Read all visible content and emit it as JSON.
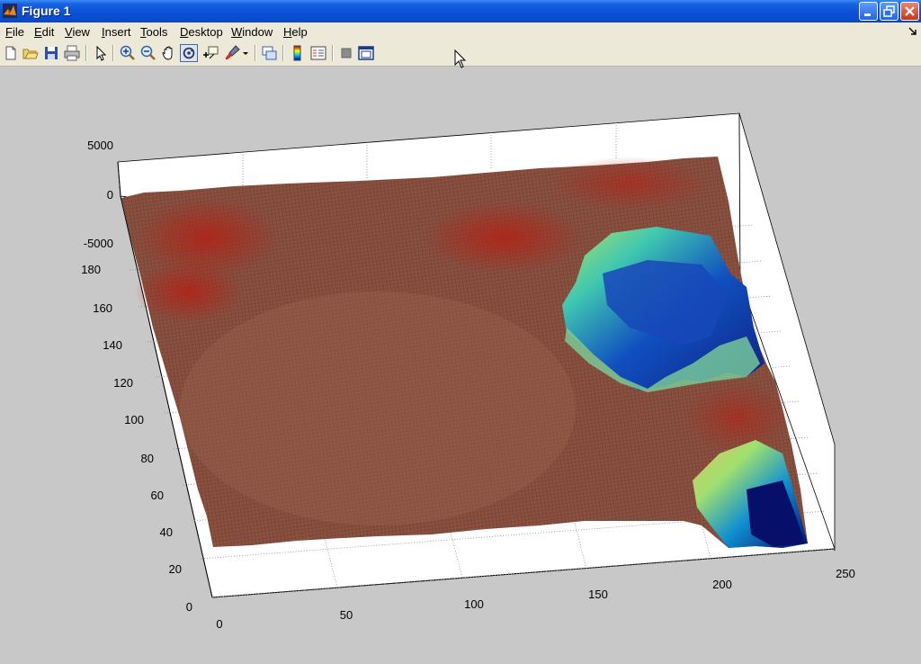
{
  "window": {
    "title": "Figure 1"
  },
  "menu": [
    "File",
    "Edit",
    "View",
    "Insert",
    "Tools",
    "Desktop",
    "Window",
    "Help"
  ],
  "toolbar": {
    "buttons": [
      "new-figure",
      "open-file",
      "save",
      "print",
      "edit-plot",
      "zoom-in",
      "zoom-out",
      "pan",
      "rotate-3d",
      "data-cursor",
      "brush",
      "link-plot",
      "insert-colorbar",
      "insert-legend",
      "hide-plot-tools",
      "show-plot-tools"
    ]
  },
  "chart_data": {
    "type": "surface",
    "colormap": "jet",
    "x_ticks": [
      "0",
      "50",
      "100",
      "150",
      "200",
      "250"
    ],
    "y_ticks": [
      "0",
      "20",
      "40",
      "60",
      "80",
      "100",
      "120",
      "140",
      "160",
      "180"
    ],
    "z_ticks": [
      "5000",
      "0",
      "-5000"
    ],
    "xlim": [
      0,
      250
    ],
    "ylim": [
      0,
      180
    ],
    "zlim": [
      -5000,
      5000
    ],
    "grid": true
  }
}
